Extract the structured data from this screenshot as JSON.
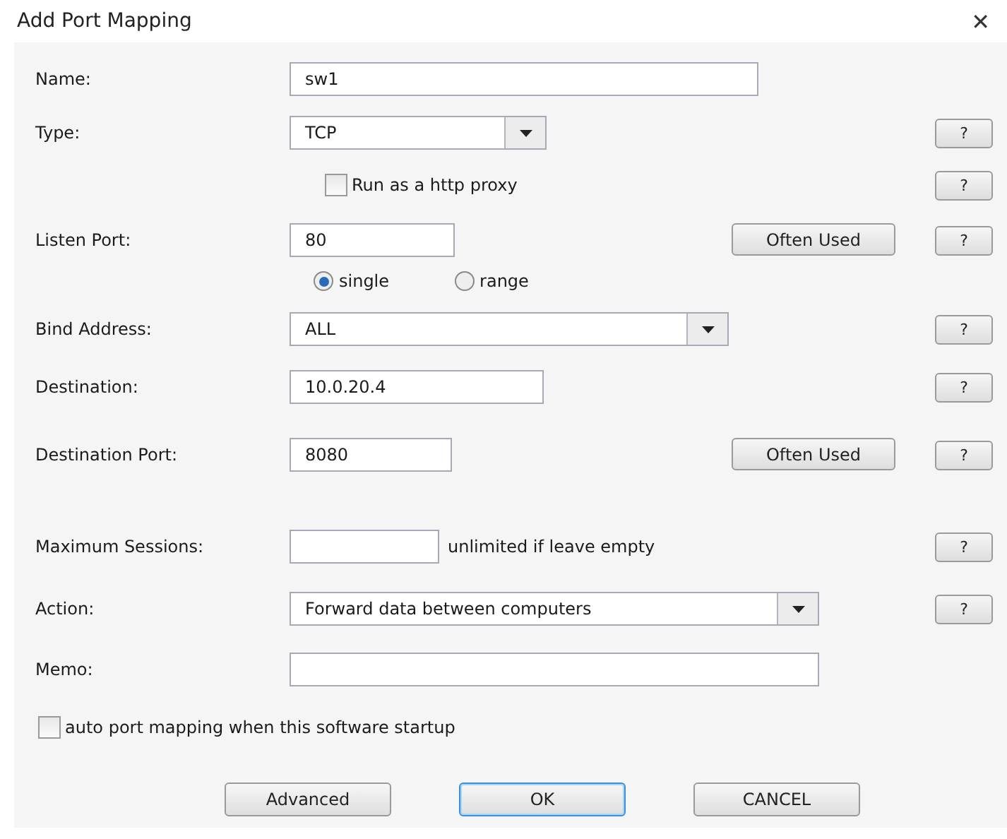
{
  "window": {
    "title": "Add Port Mapping",
    "close": "✕"
  },
  "rows": [
    {
      "kind": "text",
      "label": "Name:",
      "value": "sw1"
    },
    {
      "kind": "select",
      "label": "Type:",
      "value": "TCP",
      "help": "?"
    },
    {
      "kind": "checkbox",
      "label": "Run as a http proxy",
      "checked": false,
      "help": "?"
    },
    {
      "kind": "text",
      "label": "Listen Port:",
      "value": "80",
      "button": "Often Used",
      "help": "?"
    },
    {
      "kind": "radios",
      "options": [
        {
          "label": "single",
          "selected": true
        },
        {
          "label": "range",
          "selected": false
        }
      ]
    },
    {
      "kind": "select",
      "label": "Bind Address:",
      "value": "ALL",
      "help": "?"
    },
    {
      "kind": "text",
      "label": "Destination:",
      "value": "10.0.20.4",
      "help": "?"
    },
    {
      "kind": "text",
      "label": "Destination Port:",
      "value": "8080",
      "button": "Often Used",
      "help": "?"
    },
    {
      "kind": "text",
      "label": "Maximum Sessions:",
      "note": "unlimited if leave empty",
      "help": "?"
    },
    {
      "kind": "select",
      "label": "Action:",
      "value": "Forward data between computers",
      "help": "?"
    },
    {
      "kind": "text",
      "label": "Memo:"
    },
    {
      "kind": "checkbox",
      "label": "auto port mapping when this software startup",
      "checked": false
    }
  ],
  "buttons": [
    {
      "label": "Advanced",
      "default": false
    },
    {
      "label": "OK",
      "default": true
    },
    {
      "label": "CANCEL",
      "default": false
    }
  ]
}
